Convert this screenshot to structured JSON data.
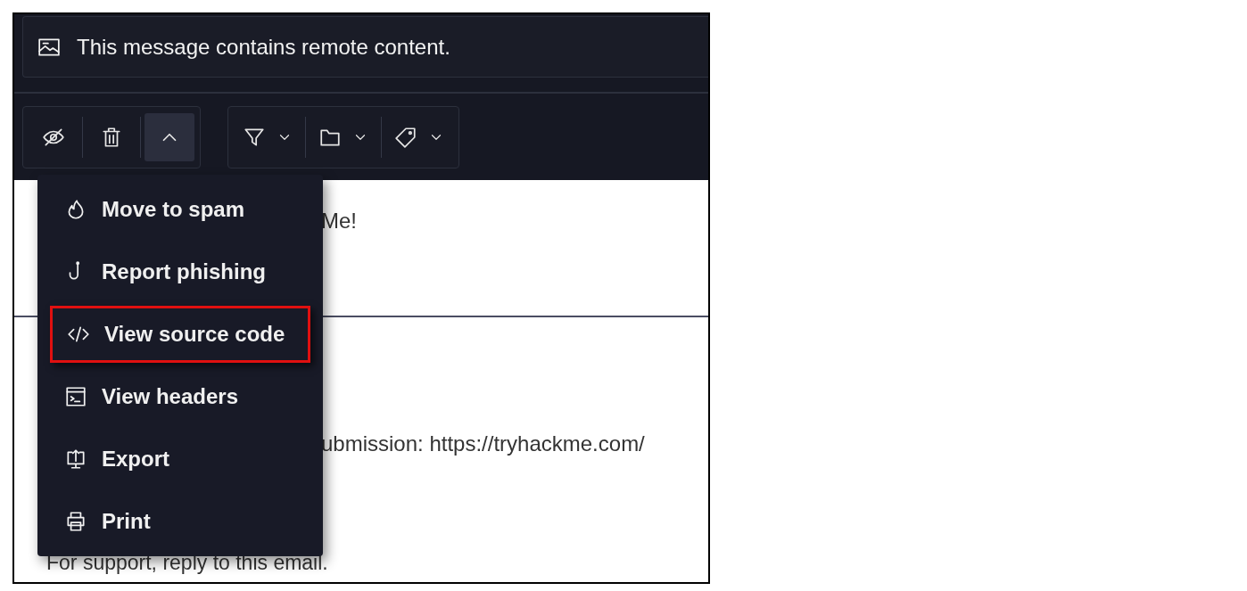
{
  "notice": {
    "text": "This message contains remote content."
  },
  "toolbar": {
    "more_expanded": true
  },
  "menu": [
    {
      "label": "Move to spam",
      "highlighted": false
    },
    {
      "label": "Report phishing",
      "highlighted": false
    },
    {
      "label": "View source code",
      "highlighted": true
    },
    {
      "label": "View headers",
      "highlighted": false
    },
    {
      "label": "Export",
      "highlighted": false
    },
    {
      "label": "Print",
      "highlighted": false
    }
  ],
  "body": {
    "lines": [
      "Me!",
      "ubmission: https://tryhackme.com/"
    ],
    "footer": "For support, reply to this email."
  }
}
